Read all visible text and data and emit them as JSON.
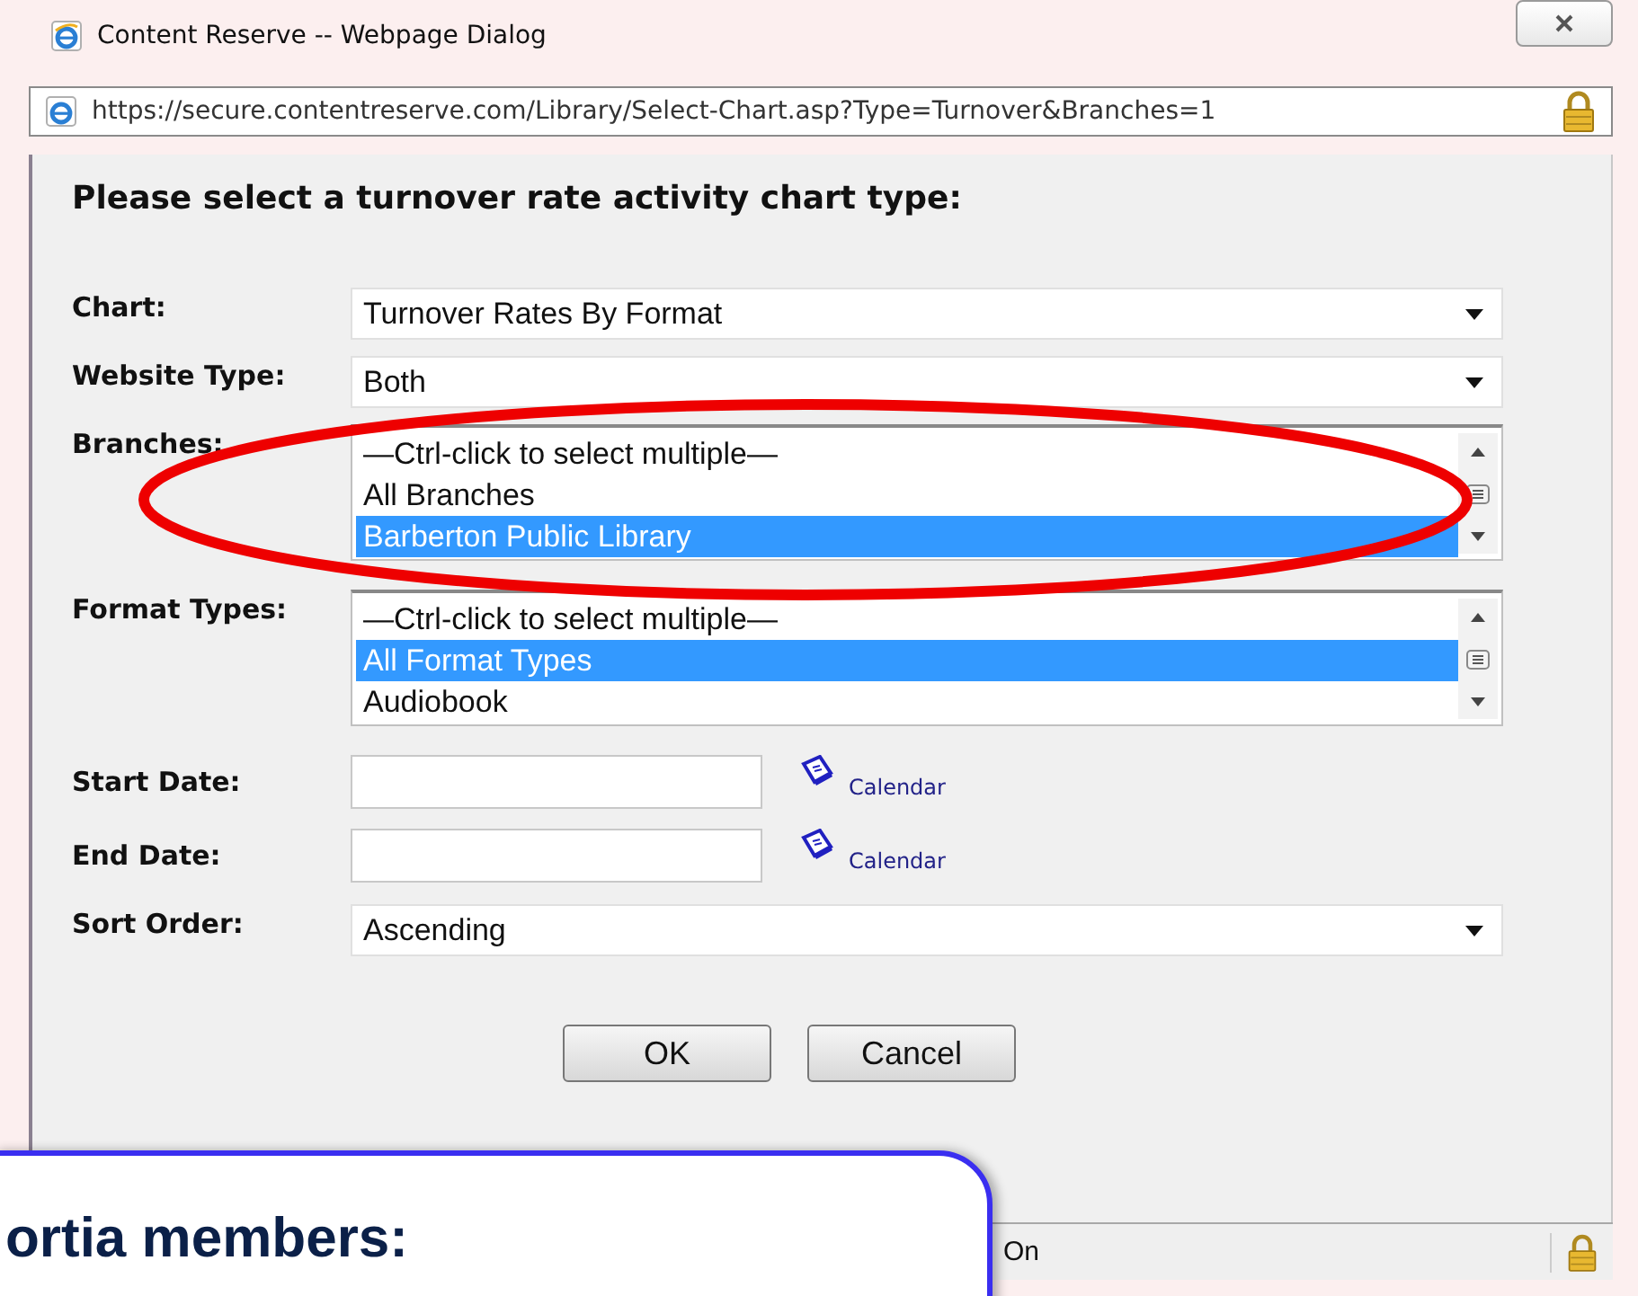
{
  "window": {
    "title": "Content Reserve -- Webpage Dialog"
  },
  "address": {
    "url": "https://secure.contentreserve.com/Library/Select-Chart.asp?Type=Turnover&Branches=1"
  },
  "heading": "Please select a turnover rate activity chart type:",
  "fields": [
    {
      "kind": "select",
      "label": "Chart:",
      "value": "Turnover Rates By Format"
    },
    {
      "kind": "select",
      "label": "Website Type:",
      "value": "Both"
    },
    {
      "kind": "listbox",
      "label": "Branches:",
      "options": [
        {
          "text": "—Ctrl-click to select multiple—",
          "selected": false
        },
        {
          "text": "All Branches",
          "selected": false
        },
        {
          "text": "Barberton Public Library",
          "selected": true
        }
      ]
    },
    {
      "kind": "listbox",
      "label": "Format Types:",
      "options": [
        {
          "text": "—Ctrl-click to select multiple—",
          "selected": false
        },
        {
          "text": "All Format Types",
          "selected": true
        },
        {
          "text": "Audiobook",
          "selected": false
        }
      ]
    },
    {
      "kind": "date",
      "label": "Start Date:",
      "link": "Calendar"
    },
    {
      "kind": "date",
      "label": "End Date:",
      "link": "Calendar"
    },
    {
      "kind": "select",
      "label": "Sort Order:",
      "value": "Ascending"
    }
  ],
  "buttons": [
    "OK",
    "Cancel"
  ],
  "status_bar": {
    "text": "On"
  },
  "callout": {
    "text": "ortia members:"
  }
}
